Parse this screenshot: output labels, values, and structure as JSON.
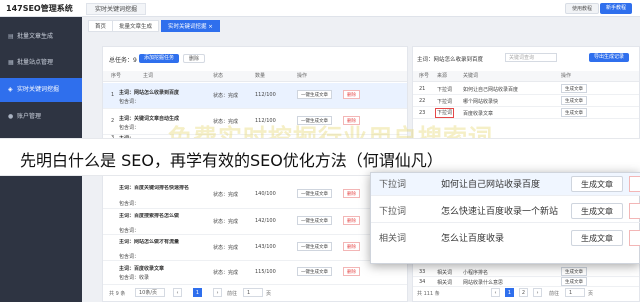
{
  "app": {
    "title": "147SEO管理系统",
    "help_label": "使用教程",
    "novice_label": "新手教程"
  },
  "top_tab": {
    "label": "实时关键词挖掘"
  },
  "breadcrumbs": [
    {
      "label": "首页"
    },
    {
      "label": "批量文章生成"
    },
    {
      "label": "实时关键词挖掘 ×"
    }
  ],
  "sidebar": {
    "items": [
      {
        "label": "批量文章生成",
        "icon": "doc-icon"
      },
      {
        "label": "批量站点管理",
        "icon": "site-icon"
      },
      {
        "label": "实时关键词挖掘",
        "icon": "mine-icon",
        "active": true
      },
      {
        "label": "账户管理",
        "icon": "user-icon"
      }
    ]
  },
  "left_panel": {
    "task_label": "总任务：9",
    "add_task_label": "添加挖掘任务",
    "delete_label": "删除",
    "headers": [
      "序号",
      "主词",
      "状态",
      "数量",
      "操作"
    ],
    "rows": [
      {
        "index": "1",
        "title": "主词：网站怎么收录到百度",
        "sub": "包含词：",
        "status": "状态：完成",
        "count": "112/100",
        "gen": "一键生成文章",
        "del": "删除"
      },
      {
        "index": "2",
        "title": "主词：关键词文章自动生成",
        "sub": "包含词：",
        "status": "状态：完成",
        "count": "112/100",
        "gen": "一键生成文章",
        "del": "删除"
      },
      {
        "index": "3",
        "title": "主词：",
        "sub": "",
        "status": "",
        "count": "",
        "gen": "",
        "del": ""
      },
      {
        "index": "",
        "title": "主词：百度关键词排名快速排名",
        "sub": "包含词：",
        "status": "状态：完成",
        "count": "140/100",
        "gen": "一键生成文章",
        "del": "删除"
      },
      {
        "index": "",
        "title": "主词：百度搜索排名怎么做",
        "sub": "包含词：",
        "status": "状态：完成",
        "count": "142/100",
        "gen": "一键生成文章",
        "del": "删除"
      },
      {
        "index": "",
        "title": "主词：网站怎么做才有流量",
        "sub": "包含词：",
        "status": "状态：完成",
        "count": "143/100",
        "gen": "一键生成文章",
        "del": "删除"
      },
      {
        "index": "",
        "title": "主词：百度收录文章",
        "sub": "包含词：收录",
        "status": "状态：完成",
        "count": "115/100",
        "gen": "一键生成文章",
        "del": "删除"
      }
    ],
    "footer": {
      "total": "共 9 条",
      "page_size": "10条/页",
      "page": "1",
      "goto_label": "前往",
      "goto_value": "1",
      "page_unit": "页"
    }
  },
  "right_panel": {
    "title": "主词：网站怎么收录到百度",
    "search_placeholder": "关键词查询",
    "export_label": "导出生成记录",
    "headers": [
      "序号",
      "来源",
      "关键词",
      "操作"
    ],
    "rows": [
      {
        "index": "21",
        "source": "下拉词",
        "keyword": "如何让自己网站收录百度",
        "gen": "生成文章"
      },
      {
        "index": "22",
        "source": "下拉词",
        "keyword": "哪个网站收录快",
        "gen": "生成文章"
      },
      {
        "index": "23",
        "source": "下拉词",
        "keyword": "百度收录文章",
        "gen": "生成文章"
      },
      {
        "index": "33",
        "source": "相关词",
        "keyword": "小程序排名",
        "gen": "生成文章"
      },
      {
        "index": "34",
        "source": "相关词",
        "keyword": "网站收录什么意思",
        "gen": "生成文章"
      }
    ],
    "footer": {
      "total": "共 111 条",
      "pages": [
        "1",
        "2"
      ],
      "goto_label": "前往",
      "goto_value": "1",
      "page_unit": "页"
    }
  },
  "zoom_popup": {
    "rows": [
      {
        "source": "下拉词",
        "keyword": "如何让自己网站收录百度",
        "gen": "生成文章"
      },
      {
        "source": "下拉词",
        "keyword": "怎么快速让百度收录一个新站",
        "gen": "生成文章"
      },
      {
        "source": "相关词",
        "keyword": "怎么让百度收录",
        "gen": "生成文章"
      }
    ]
  },
  "watermark": {
    "text": "免费实时挖掘行业用户搜索词"
  },
  "headline": {
    "text": "先明白什么是 SEO，再学有效的SEO优化方法（何谓仙凡）"
  },
  "colors": {
    "accent": "#2f6fed",
    "sidebar_bg": "#2e3442",
    "danger": "#e54848"
  }
}
